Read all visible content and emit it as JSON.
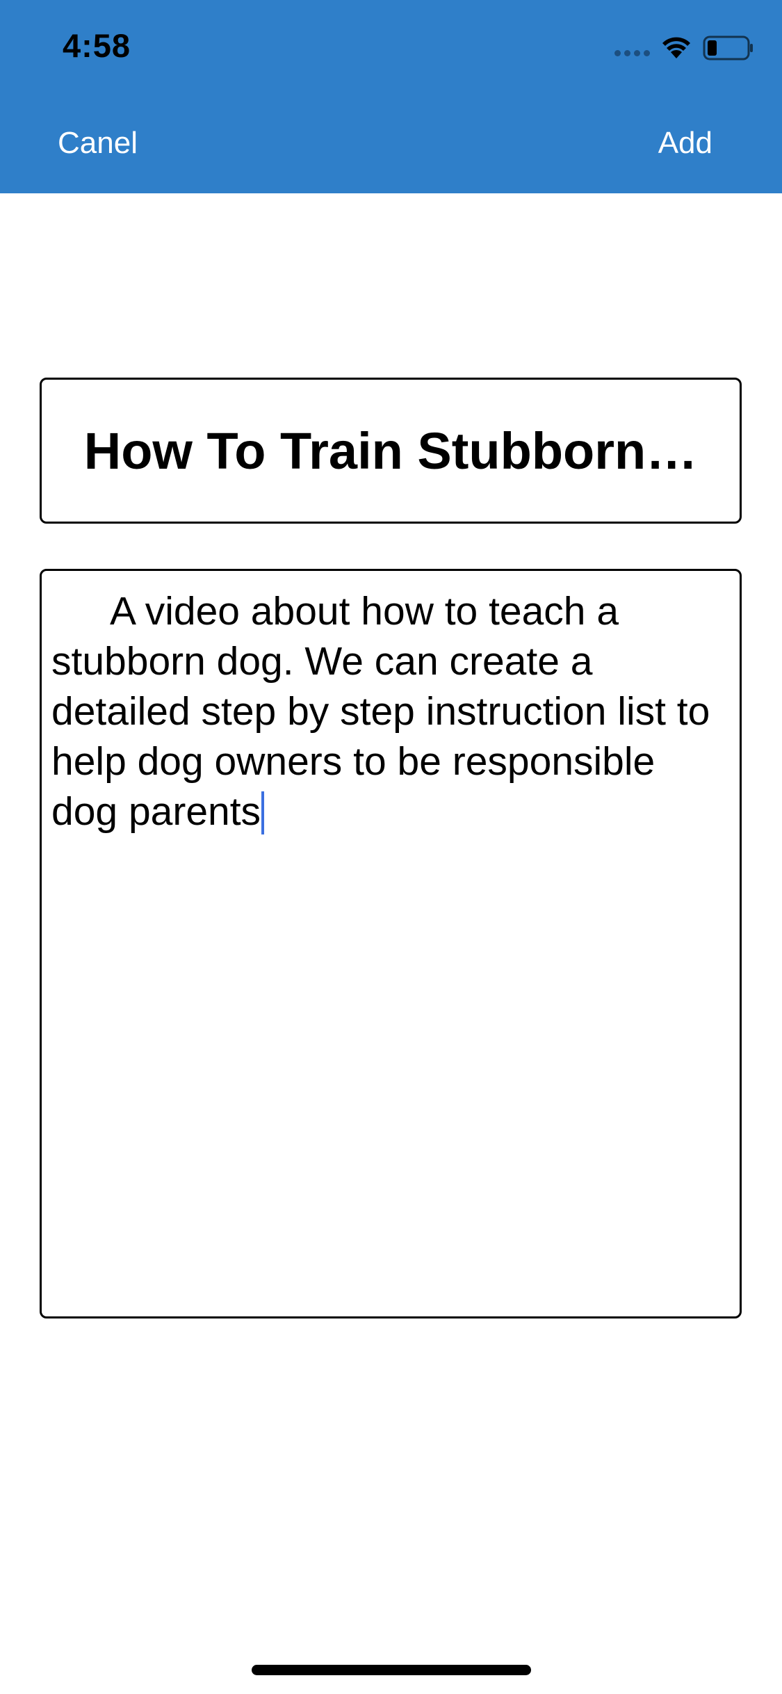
{
  "status_bar": {
    "time": "4:58",
    "icons": [
      "signal-dots-icon",
      "wifi-icon",
      "battery-icon"
    ],
    "battery_level": 0.2
  },
  "nav": {
    "cancel_label": "Canel",
    "add_label": "Add"
  },
  "form": {
    "title_value": "How To Train Stubborn…",
    "description_value": "A video about how to teach a stubborn dog. We can create a detailed step by step instruction list to help dog owners to be responsible dog parents"
  },
  "colors": {
    "header_bg": "#2F7FC9",
    "caret": "#3B6FE0"
  }
}
